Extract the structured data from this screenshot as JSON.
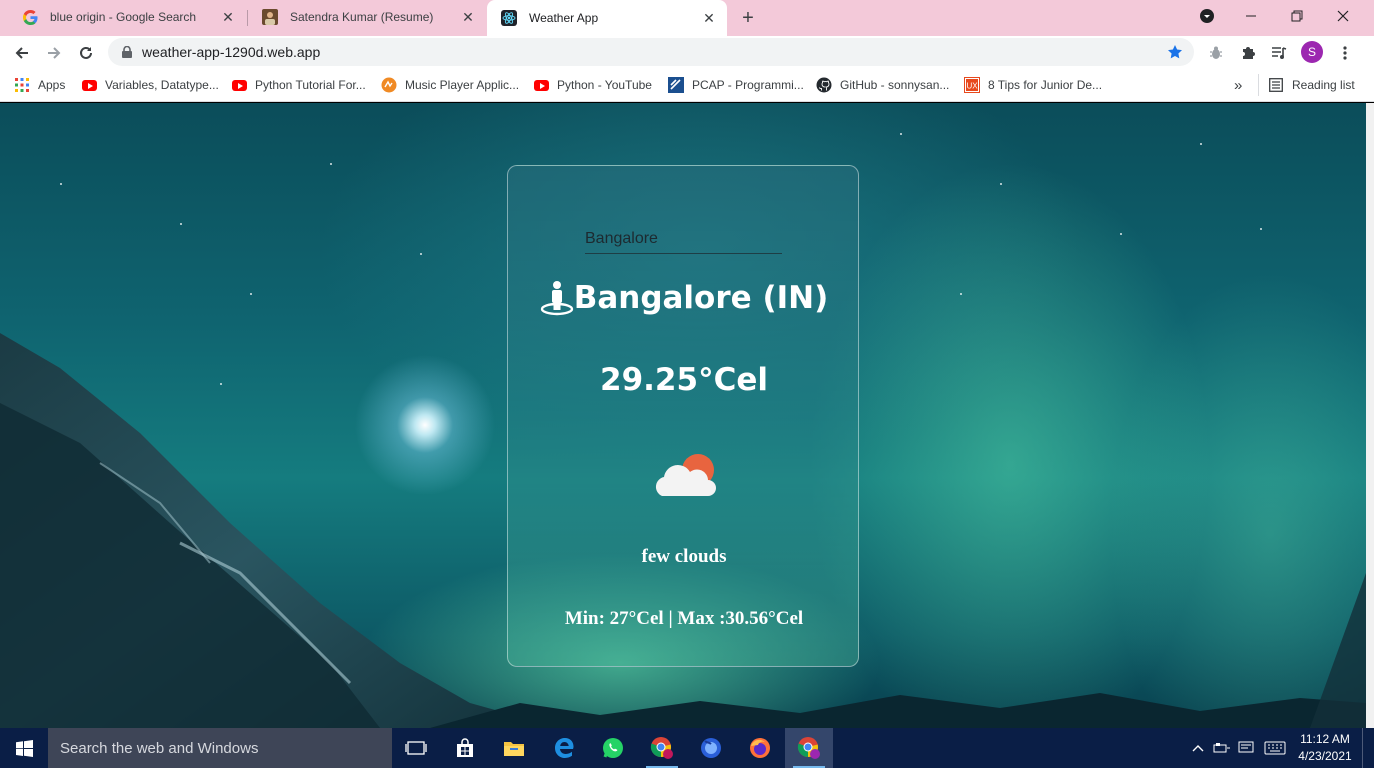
{
  "browser": {
    "tabs": [
      {
        "title": "blue origin - Google Search",
        "icon": "google-icon",
        "active": false
      },
      {
        "title": "Satendra Kumar (Resume)",
        "icon": "profile-photo-icon",
        "active": false
      },
      {
        "title": "Weather App",
        "icon": "react-icon",
        "active": true
      }
    ],
    "new_tab_symbol": "+",
    "url": "weather-app-1290d.web.app",
    "profile_initial": "S"
  },
  "bookmarks": {
    "apps_label": "Apps",
    "items": [
      {
        "label": "Variables, Datatype...",
        "icon": "youtube-icon"
      },
      {
        "label": "Python Tutorial For...",
        "icon": "youtube-icon"
      },
      {
        "label": "Music Player Applic...",
        "icon": "music-app-icon"
      },
      {
        "label": "Python - YouTube",
        "icon": "youtube-icon"
      },
      {
        "label": "PCAP - Programmi...",
        "icon": "pcap-icon"
      },
      {
        "label": "GitHub - sonnysan...",
        "icon": "github-icon"
      },
      {
        "label": "8 Tips for Junior De...",
        "icon": "ux-icon"
      }
    ],
    "overflow_symbol": "»",
    "reading_list_label": "Reading list"
  },
  "weather": {
    "search_value": "Bangalore",
    "location": "Bangalore (IN)",
    "temperature": "29.25°Cel",
    "icon": "few-clouds-icon",
    "description": "few clouds",
    "min_max": "Min: 27°Cel | Max :30.56°Cel"
  },
  "taskbar": {
    "search_placeholder": "Search the web and Windows",
    "time": "11:12 AM",
    "date": "4/23/2021"
  },
  "colors": {
    "tabstrip": "#f3c9d9",
    "taskbar": "#0a1e46",
    "bookmark_star": "#1a73e8",
    "profile_avatar": "#9c27b0"
  }
}
